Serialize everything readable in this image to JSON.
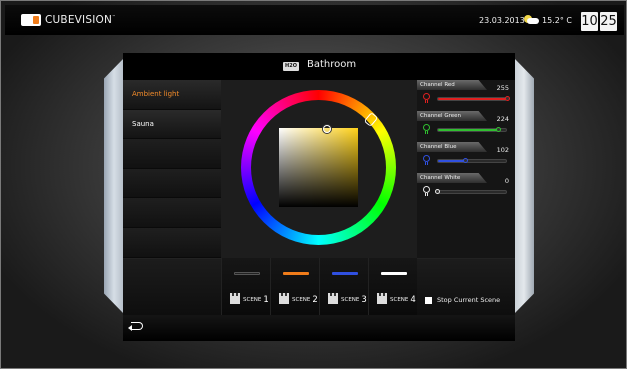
{
  "header": {
    "brand": "CUBEVISION",
    "brand_tm": "™",
    "date": "23.03.2013",
    "weather_icon": "partly-cloudy-icon",
    "temperature": "15.2° C",
    "clock_hour": "10",
    "clock_minute": "25"
  },
  "room": {
    "icon_label": "H2O",
    "title": "Bathroom"
  },
  "lights": [
    {
      "label": "Ambient light",
      "active": true
    },
    {
      "label": "Sauna",
      "active": false
    }
  ],
  "channels": [
    {
      "label": "Channel Red",
      "value": "255",
      "level": 1.0,
      "color": "#e02020"
    },
    {
      "label": "Channel Green",
      "value": "224",
      "level": 0.878,
      "color": "#30c030"
    },
    {
      "label": "Channel Blue",
      "value": "102",
      "level": 0.4,
      "color": "#3050e0"
    },
    {
      "label": "Channel White",
      "value": "0",
      "level": 0.0,
      "color": "#e8e8e8"
    }
  ],
  "scenes": [
    {
      "word": "SCENE",
      "number": "1",
      "color": "#222222"
    },
    {
      "word": "SCENE",
      "number": "2",
      "color": "#f07c1a"
    },
    {
      "word": "SCENE",
      "number": "3",
      "color": "#3050e0"
    },
    {
      "word": "SCENE",
      "number": "4",
      "color": "#ffffff"
    }
  ],
  "stop_scene_label": "Stop Current Scene",
  "colors": {
    "accent": "#f08a2a",
    "selected_color": "#ffd21a"
  }
}
